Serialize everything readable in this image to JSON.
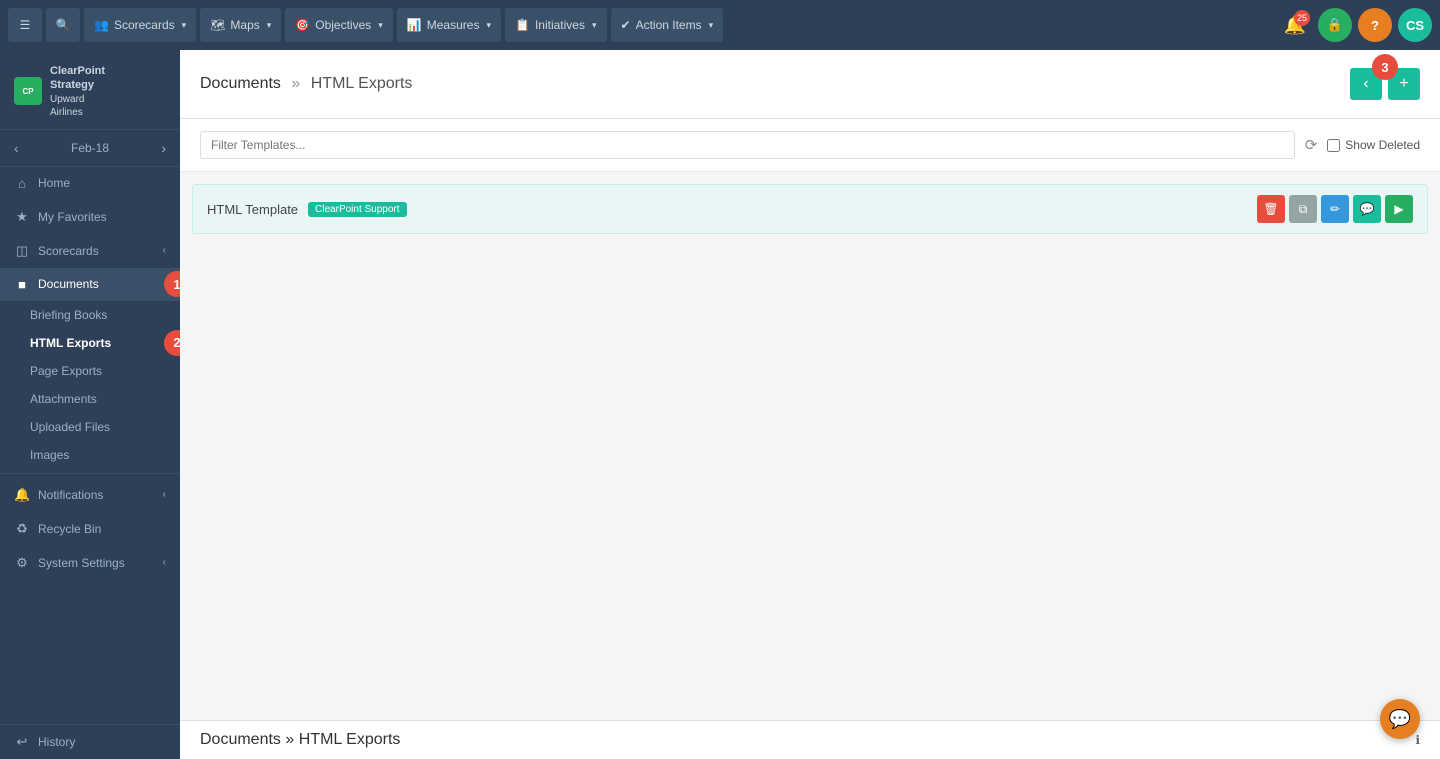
{
  "topNav": {
    "menuIcon": "☰",
    "searchIcon": "🔍",
    "items": [
      {
        "id": "scorecards",
        "label": "Scorecards",
        "icon": "👥"
      },
      {
        "id": "maps",
        "label": "Maps",
        "icon": "🗺"
      },
      {
        "id": "objectives",
        "label": "Objectives",
        "icon": "🎯"
      },
      {
        "id": "measures",
        "label": "Measures",
        "icon": "📊"
      },
      {
        "id": "initiatives",
        "label": "Initiatives",
        "icon": "📋"
      },
      {
        "id": "action-items",
        "label": "Action Items",
        "icon": "✔"
      }
    ],
    "notifCount": "25",
    "avatarGreen": "🔒",
    "avatarOrange": "?",
    "avatarTeal": "CS"
  },
  "sidebar": {
    "logo": {
      "brand": "ClearPoint",
      "sub": "Strategy",
      "company": "Upward",
      "company2": "Airlines"
    },
    "period": "Feb-18",
    "items": [
      {
        "id": "home",
        "label": "Home",
        "icon": "⌂",
        "active": false
      },
      {
        "id": "favorites",
        "label": "My Favorites",
        "icon": "★",
        "active": false
      },
      {
        "id": "scorecards",
        "label": "Scorecards",
        "icon": "◫",
        "active": false,
        "hasChevron": true
      },
      {
        "id": "documents",
        "label": "Documents",
        "icon": "■",
        "active": true
      },
      {
        "id": "briefing-books",
        "label": "Briefing Books",
        "sub": true,
        "active": false
      },
      {
        "id": "html-exports",
        "label": "HTML Exports",
        "sub": true,
        "active": true
      },
      {
        "id": "page-exports",
        "label": "Page Exports",
        "sub": true,
        "active": false
      },
      {
        "id": "attachments",
        "label": "Attachments",
        "sub": true,
        "active": false
      },
      {
        "id": "uploaded-files",
        "label": "Uploaded Files",
        "sub": true,
        "active": false
      },
      {
        "id": "images",
        "label": "Images",
        "sub": true,
        "active": false
      }
    ],
    "notifications": {
      "label": "Notifications",
      "icon": "🔔",
      "hasChevron": true
    },
    "recycleBin": {
      "label": "Recycle Bin",
      "icon": "♻"
    },
    "systemSettings": {
      "label": "System Settings",
      "icon": "⚙",
      "hasChevron": true
    },
    "history": {
      "label": "History",
      "icon": "↩"
    }
  },
  "content": {
    "breadcrumb1": "Documents",
    "separator": "»",
    "breadcrumb2": "HTML Exports",
    "filterPlaceholder": "Filter Templates...",
    "showDeletedLabel": "Show Deleted",
    "templates": [
      {
        "name": "HTML Template",
        "tag": "ClearPoint Support",
        "actions": [
          "delete",
          "copy",
          "edit",
          "comment",
          "play"
        ]
      }
    ]
  },
  "footer": {
    "breadcrumb1": "Documents",
    "separator": "»",
    "breadcrumb2": "HTML Exports"
  },
  "callouts": {
    "badge1": "1",
    "badge2": "2",
    "badge3": "3"
  },
  "colors": {
    "teal": "#1abc9c",
    "darkNav": "#2e4057",
    "red": "#e74c3c",
    "green": "#27ae60",
    "orange": "#e67e22"
  }
}
